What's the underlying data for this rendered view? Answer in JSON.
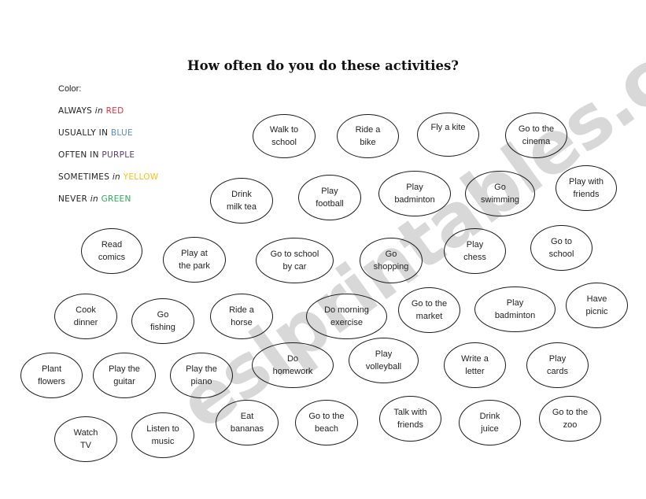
{
  "title": "How often do you do these activities?",
  "legend": {
    "label": "Color:",
    "items": [
      {
        "prefix": "ALWAYS",
        "connector": " in ",
        "color_name": "RED",
        "color": "#e8323c"
      },
      {
        "prefix": "USUALLY",
        "connector": " IN ",
        "color_name": "BLUE",
        "color": "#5b8cc8"
      },
      {
        "prefix": "OFTEN",
        "connector": " IN ",
        "color_name": "PURPLE",
        "color": "#5a3c78"
      },
      {
        "prefix": "SOMETIMES",
        "connector": " in ",
        "color_name": "YELLOW",
        "color": "#f2c21c"
      },
      {
        "prefix": "NEVER",
        "connector": " in ",
        "color_name": "GREEN",
        "color": "#2faa5a"
      }
    ]
  },
  "watermark": "eslprintables.com",
  "activities": [
    {
      "line1": "Walk to",
      "line2": "school"
    },
    {
      "line1": "Ride a",
      "line2": "bike"
    },
    {
      "line1": "Fly a kite",
      "line2": ""
    },
    {
      "line1": "Go to the",
      "line2": "cinema"
    },
    {
      "line1": "Drink",
      "line2": "milk tea"
    },
    {
      "line1": "Play",
      "line2": "football"
    },
    {
      "line1": "Play",
      "line2": "badminton"
    },
    {
      "line1": "Go",
      "line2": "swimming"
    },
    {
      "line1": "Play with",
      "line2": "friends"
    },
    {
      "line1": "Read",
      "line2": "comics"
    },
    {
      "line1": "Play at",
      "line2": "the park"
    },
    {
      "line1": "Go to school",
      "line2": "by car"
    },
    {
      "line1": "Go",
      "line2": "shopping"
    },
    {
      "line1": "Play",
      "line2": "chess"
    },
    {
      "line1": "Go to",
      "line2": "school"
    },
    {
      "line1": "Cook",
      "line2": "dinner"
    },
    {
      "line1": "Go",
      "line2": "fishing"
    },
    {
      "line1": "Ride a",
      "line2": "horse"
    },
    {
      "line1": "Do morning",
      "line2": "exercise"
    },
    {
      "line1": "Go to the",
      "line2": "market"
    },
    {
      "line1": "Play",
      "line2": "badminton"
    },
    {
      "line1": "Have",
      "line2": "picnic"
    },
    {
      "line1": "Plant",
      "line2": "flowers"
    },
    {
      "line1": "Play the",
      "line2": "guitar"
    },
    {
      "line1": "Play the",
      "line2": "piano"
    },
    {
      "line1": "Do",
      "line2": "homework"
    },
    {
      "line1": "Play",
      "line2": "volleyball"
    },
    {
      "line1": "Write a",
      "line2": "letter"
    },
    {
      "line1": "Play",
      "line2": "cards"
    },
    {
      "line1": "Watch",
      "line2": "TV"
    },
    {
      "line1": "Listen to",
      "line2": "music"
    },
    {
      "line1": "Eat",
      "line2": "bananas"
    },
    {
      "line1": "Go to the",
      "line2": "beach"
    },
    {
      "line1": "Talk with",
      "line2": "friends"
    },
    {
      "line1": "Drink",
      "line2": "juice"
    },
    {
      "line1": "Go to the",
      "line2": "zoo"
    }
  ]
}
